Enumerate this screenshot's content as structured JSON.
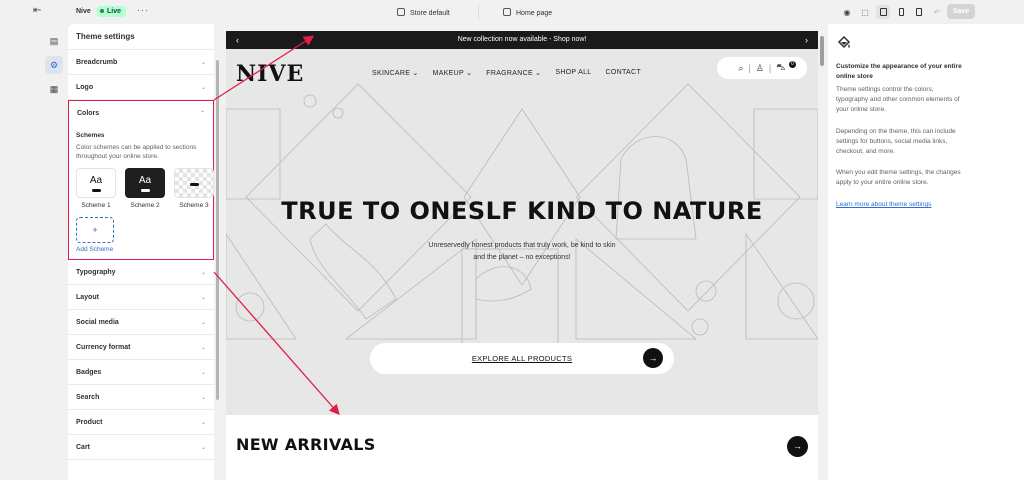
{
  "topbar": {
    "store_name": "Nive",
    "status": "Live",
    "more": "···",
    "theme_label": "Store default",
    "page_label": "Home page",
    "save_label": "Save"
  },
  "panel": {
    "title": "Theme settings",
    "sections_before": [
      "Breadcrumb",
      "Logo"
    ],
    "colors": {
      "label": "Colors",
      "schemes_heading": "Schemes",
      "description": "Color schemes can be applied to sections throughout your online store.",
      "schemes": [
        {
          "label": "Scheme 1",
          "sample": "Aa",
          "bg": "#ffffff",
          "fg": "#111111"
        },
        {
          "label": "Scheme 2",
          "sample": "Aa",
          "bg": "#1f1f1f",
          "fg": "#ffffff"
        },
        {
          "label": "Scheme 3",
          "sample": "",
          "bg": "transparent",
          "fg": "#111111"
        }
      ],
      "add_label": "Add Scheme"
    },
    "sections_after": [
      "Typography",
      "Layout",
      "Social media",
      "Currency format",
      "Badges",
      "Search",
      "Product",
      "Cart"
    ]
  },
  "preview": {
    "announcement": "New collection now available - Shop now!",
    "logo": "NIVE",
    "nav": [
      "SKINCARE",
      "MAKEUP",
      "FRAGRANCE",
      "SHOP ALL",
      "CONTACT"
    ],
    "cart_count": "0",
    "hero_title": "TRUE TO ONESLF KIND TO NATURE",
    "hero_subtitle": "Unreservedly honest products that truly work, be kind to skin and the planet – no exceptions!",
    "cta_label": "EXPLORE ALL PRODUCTS",
    "section_title": "NEW ARRIVALS"
  },
  "info": {
    "heading": "Customize the appearance of your entire online store",
    "paragraphs": [
      "Theme settings control the colors, typography and other common elements of your online store.",
      "Depending on the theme, this can include settings for buttons, social media links, checkout, and more.",
      "When you edit theme settings, the changes apply to your entire online store."
    ],
    "link": "Learn more about theme settings"
  },
  "colors": {
    "highlight": "#e11d48",
    "link": "#2c6ecb",
    "live_bg": "#b4fed2"
  }
}
